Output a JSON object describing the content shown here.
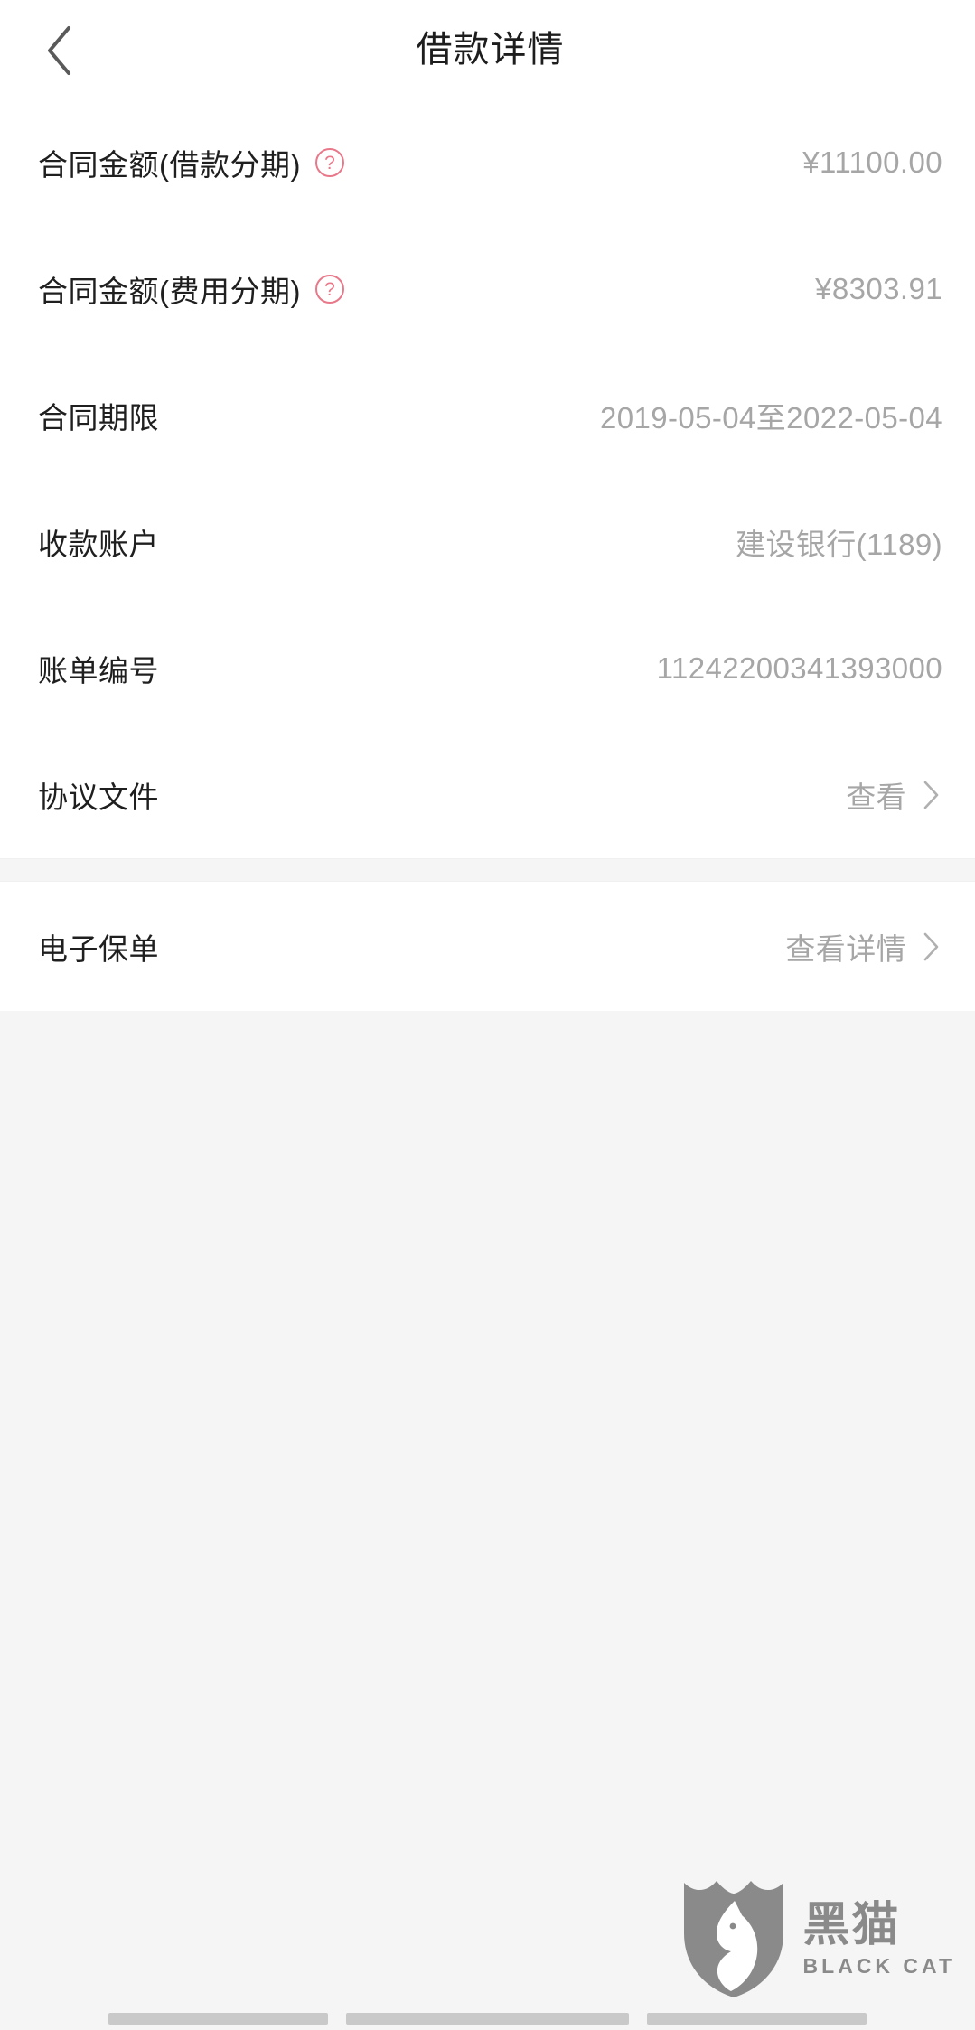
{
  "header": {
    "title": "借款详情",
    "back_icon": "chevron-left-icon"
  },
  "colors": {
    "page_bg": "#f5f5f5",
    "card_bg": "#ffffff",
    "label_text": "#1f1f1f",
    "value_text": "#a6a6a6",
    "help_icon": "#e8788a",
    "watermark": "#8a8a8a"
  },
  "detail_rows": [
    {
      "label": "合同金额(借款分期)",
      "has_help": true,
      "help_glyph": "?",
      "value": "¥11100.00",
      "type": "value"
    },
    {
      "label": "合同金额(费用分期)",
      "has_help": true,
      "help_glyph": "?",
      "value": "¥8303.91",
      "type": "value"
    },
    {
      "label": "合同期限",
      "has_help": false,
      "value": "2019-05-04至2022-05-04",
      "type": "value"
    },
    {
      "label": "收款账户",
      "has_help": false,
      "value": "建设银行(1189)",
      "type": "value"
    },
    {
      "label": "账单编号",
      "has_help": false,
      "value": "11242200341393000",
      "type": "value"
    },
    {
      "label": "协议文件",
      "has_help": false,
      "value": "查看",
      "type": "link",
      "chevron": "chevron-right-icon"
    }
  ],
  "policy_section": [
    {
      "label": "电子保单",
      "has_help": false,
      "value": "查看详情",
      "type": "link",
      "chevron": "chevron-right-icon"
    }
  ],
  "watermark": {
    "cn": "黑猫",
    "en": "BLACK CAT",
    "logo": "black-cat-shield-logo"
  }
}
